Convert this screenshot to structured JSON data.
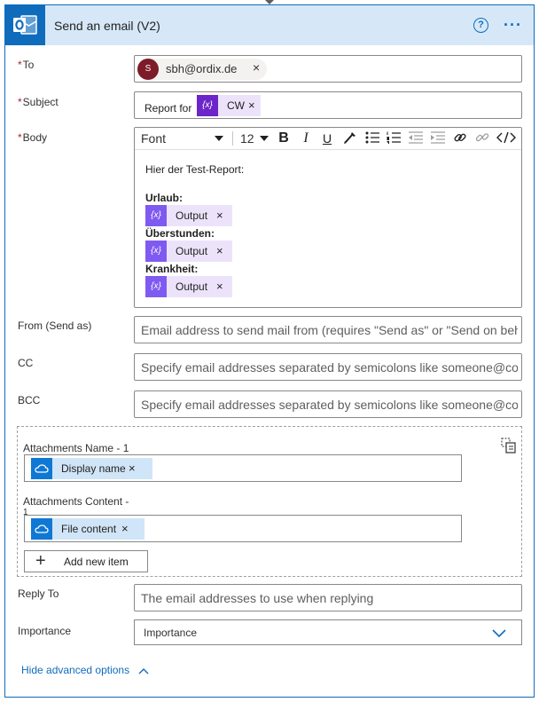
{
  "header": {
    "title": "Send an email (V2)",
    "help_glyph": "?",
    "more_glyph": "···"
  },
  "fields": {
    "to": {
      "label": "To",
      "required_mark": "*",
      "recipient": {
        "initial": "S",
        "email": "sbh@ordix.de",
        "remove": "×"
      }
    },
    "subject": {
      "label": "Subject",
      "required_mark": "*",
      "prefix_text": "Report for",
      "token": {
        "icon_text": "{x}",
        "label": "CW",
        "remove": "×"
      }
    },
    "body": {
      "label": "Body",
      "required_mark": "*",
      "toolbar": {
        "font": "Font",
        "size": "12"
      },
      "intro": "Hier der Test-Report:",
      "sections": [
        {
          "heading": "Urlaub:",
          "token_label": "Output",
          "token_icon": "{x}",
          "remove": "×"
        },
        {
          "heading": "Überstunden:",
          "token_label": "Output",
          "token_icon": "{x}",
          "remove": "×"
        },
        {
          "heading": "Krankheit:",
          "token_label": "Output",
          "token_icon": "{x}",
          "remove": "×"
        }
      ]
    },
    "from": {
      "label": "From (Send as)",
      "placeholder": "Email address to send mail from (requires \"Send as\" or \"Send on beh"
    },
    "cc": {
      "label": "CC",
      "placeholder": "Specify email addresses separated by semicolons like someone@con"
    },
    "bcc": {
      "label": "BCC",
      "placeholder": "Specify email addresses separated by semicolons like someone@con"
    },
    "attachments": {
      "name_label": "Attachments Name - 1",
      "name_token": {
        "label": "Display name",
        "remove": "×"
      },
      "content_label": "Attachments Content -",
      "content_label_cont": "1",
      "content_token": {
        "label": "File content",
        "remove": "×"
      },
      "add_item": "Add new item"
    },
    "reply_to": {
      "label": "Reply To",
      "placeholder": "The email addresses to use when replying"
    },
    "importance": {
      "label": "Importance",
      "value": "Importance"
    }
  },
  "footer": {
    "hide_advanced": "Hide advanced options"
  },
  "colors": {
    "accent": "#0f6cbd",
    "header_bg": "#d6e8f8",
    "required": "#a4262c",
    "token_purple": "#7f5af0",
    "token_bg": "#ece3fb",
    "onedrive_blue": "#0f78d4",
    "avatar": "#7d1b29"
  },
  "icons": [
    "outlook-icon",
    "help-icon",
    "more-icon",
    "expression-icon",
    "onedrive-icon",
    "bold-icon",
    "italic-icon",
    "underline-icon",
    "paint-icon",
    "bullet-list-icon",
    "numbered-list-icon",
    "outdent-icon",
    "indent-icon",
    "link-icon",
    "unlink-icon",
    "code-view-icon",
    "swap-icon",
    "chevron-down-icon",
    "chevron-up-icon",
    "plus-icon"
  ]
}
